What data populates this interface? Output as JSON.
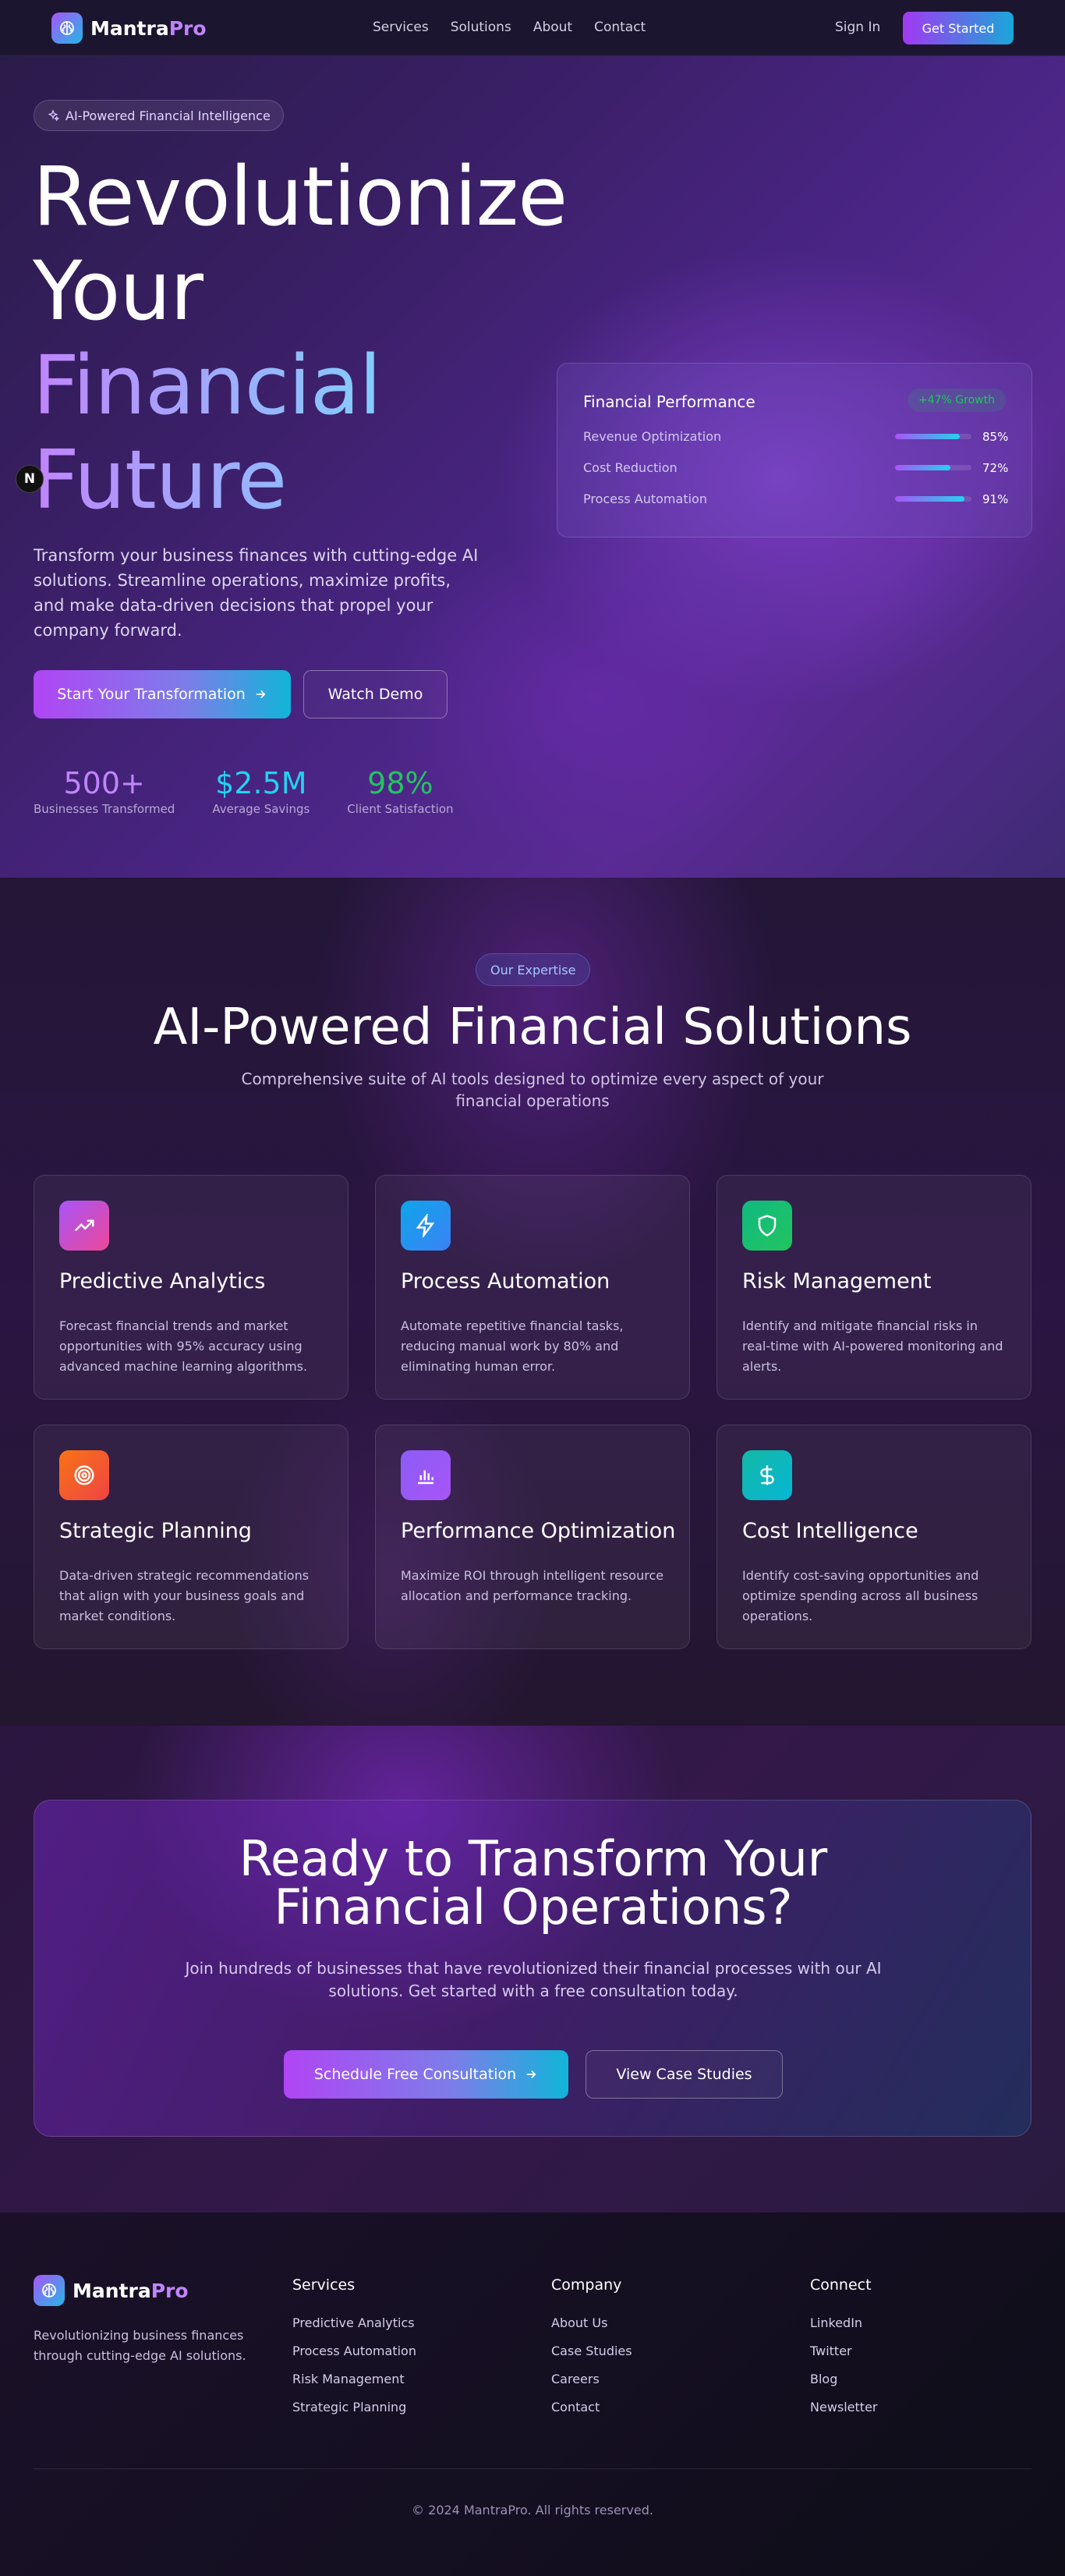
{
  "nav": {
    "brand_main": "Mantra",
    "brand_accent": "Pro",
    "links": [
      "Services",
      "Solutions",
      "About",
      "Contact"
    ],
    "signin": "Sign In",
    "cta": "Get Started"
  },
  "hero": {
    "pill": "AI-Powered Financial Intelligence",
    "title_line1": "Revolutionize",
    "title_line2": "Your",
    "title_line3": "Financial",
    "title_line4": "Future",
    "description": "Transform your business finances with cutting-edge AI solutions. Streamline operations, maximize profits, and make data-driven decisions that propel your company forward.",
    "cta_primary": "Start Your Transformation",
    "cta_secondary": "Watch Demo",
    "stats": [
      {
        "value": "500+",
        "label": "Businesses Transformed",
        "color": "#c084fc"
      },
      {
        "value": "$2.5M",
        "label": "Average Savings",
        "color": "#22d3ee"
      },
      {
        "value": "98%",
        "label": "Client Satisfaction",
        "color": "#22c55e"
      }
    ],
    "floating_badge": "N"
  },
  "performance_card": {
    "title": "Financial Performance",
    "badge": "+47% Growth",
    "rows": [
      {
        "label": "Revenue Optimization",
        "value": "85%",
        "fraction": 0.85
      },
      {
        "label": "Cost Reduction",
        "value": "72%",
        "fraction": 0.72
      },
      {
        "label": "Process Automation",
        "value": "91%",
        "fraction": 0.91
      }
    ]
  },
  "expertise": {
    "pill": "Our Expertise",
    "title": "AI-Powered Financial Solutions",
    "subtitle": "Comprehensive suite of AI tools designed to optimize every aspect of your financial operations",
    "cards": [
      {
        "title": "Predictive Analytics",
        "desc": "Forecast financial trends and market opportunities with 95% accuracy using advanced machine learning algorithms.",
        "icon": "trending-up-icon",
        "colors": [
          "#a855f7",
          "#ec4899"
        ]
      },
      {
        "title": "Process Automation",
        "desc": "Automate repetitive financial tasks, reducing manual work by 80% and eliminating human error.",
        "icon": "lightning-icon",
        "colors": [
          "#0ea5e9",
          "#3b82f6"
        ]
      },
      {
        "title": "Risk Management",
        "desc": "Identify and mitigate financial risks in real-time with AI-powered monitoring and alerts.",
        "icon": "shield-icon",
        "colors": [
          "#10b981",
          "#22c55e"
        ]
      },
      {
        "title": "Strategic Planning",
        "desc": "Data-driven strategic recommendations that align with your business goals and market conditions.",
        "icon": "target-icon",
        "colors": [
          "#f97316",
          "#ef4444"
        ]
      },
      {
        "title": "Performance Optimization",
        "desc": "Maximize ROI through intelligent resource allocation and performance tracking.",
        "icon": "bar-chart-icon",
        "colors": [
          "#8b5cf6",
          "#a855f7"
        ]
      },
      {
        "title": "Cost Intelligence",
        "desc": "Identify cost-saving opportunities and optimize spending across all business operations.",
        "icon": "dollar-icon",
        "colors": [
          "#14b8a6",
          "#06b6d4"
        ]
      }
    ]
  },
  "cta_section": {
    "title_line1": "Ready to Transform Your",
    "title_line2": "Financial Operations?",
    "subtitle": "Join hundreds of businesses that have revolutionized their financial processes with our AI solutions. Get started with a free consultation today.",
    "primary": "Schedule Free Consultation",
    "secondary": "View Case Studies"
  },
  "footer": {
    "brand_main": "Mantra",
    "brand_accent": "Pro",
    "tagline": "Revolutionizing business finances through cutting-edge AI solutions.",
    "columns": [
      {
        "heading": "Services",
        "items": [
          "Predictive Analytics",
          "Process Automation",
          "Risk Management",
          "Strategic Planning"
        ]
      },
      {
        "heading": "Company",
        "items": [
          "About Us",
          "Case Studies",
          "Careers",
          "Contact"
        ]
      },
      {
        "heading": "Connect",
        "items": [
          "LinkedIn",
          "Twitter",
          "Blog",
          "Newsletter"
        ]
      }
    ],
    "copyright": "© 2024 MantraPro. All rights reserved."
  }
}
